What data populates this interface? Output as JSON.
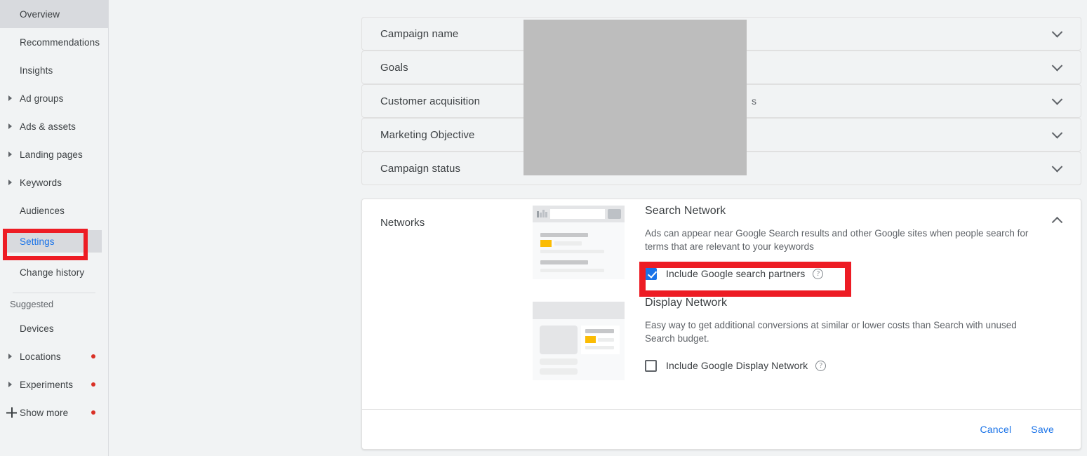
{
  "sidebar": {
    "items": [
      {
        "label": "Overview",
        "expandable": false,
        "selected": true,
        "dot": false
      },
      {
        "label": "Recommendations",
        "expandable": false,
        "selected": false,
        "dot": false
      },
      {
        "label": "Insights",
        "expandable": false,
        "selected": false,
        "dot": false
      },
      {
        "label": "Ad groups",
        "expandable": true,
        "selected": false,
        "dot": false
      },
      {
        "label": "Ads & assets",
        "expandable": true,
        "selected": false,
        "dot": false
      },
      {
        "label": "Landing pages",
        "expandable": true,
        "selected": false,
        "dot": false
      },
      {
        "label": "Keywords",
        "expandable": true,
        "selected": false,
        "dot": false
      },
      {
        "label": "Audiences",
        "expandable": false,
        "selected": false,
        "dot": false
      },
      {
        "label": "Settings",
        "expandable": false,
        "selected": true,
        "dot": false
      },
      {
        "label": "Change history",
        "expandable": false,
        "selected": false,
        "dot": false
      }
    ],
    "section_label": "Suggested",
    "suggested_items": [
      {
        "label": "Devices",
        "expandable": false,
        "dot": false
      },
      {
        "label": "Locations",
        "expandable": true,
        "dot": true
      },
      {
        "label": "Experiments",
        "expandable": true,
        "dot": true
      }
    ],
    "show_more": {
      "label": "Show more",
      "dot": true
    }
  },
  "accordion": {
    "rows": [
      {
        "label": "Campaign name",
        "value": ""
      },
      {
        "label": "Goals",
        "value": ""
      },
      {
        "label": "Customer acquisition",
        "value": "s"
      },
      {
        "label": "Marketing Objective",
        "value": ""
      },
      {
        "label": "Campaign status",
        "value": ""
      }
    ]
  },
  "networks": {
    "title": "Networks",
    "search": {
      "heading": "Search Network",
      "description": "Ads can appear near Google Search results and other Google sites when people search for terms that are relevant to your keywords",
      "checkbox_label": "Include Google search partners",
      "checked": true,
      "help_glyph": "?"
    },
    "display": {
      "heading": "Display Network",
      "description": "Easy way to get additional conversions at similar or lower costs than Search with unused Search budget.",
      "checkbox_label": "Include Google Display Network",
      "checked": false,
      "help_glyph": "?"
    },
    "footer": {
      "cancel_label": "Cancel",
      "save_label": "Save"
    }
  },
  "colors": {
    "accent": "#1a73e8",
    "highlight": "#ED1C24",
    "page_bg": "#f1f3f4",
    "dot": "#d93025",
    "ad_yellow": "#fbbc04"
  }
}
